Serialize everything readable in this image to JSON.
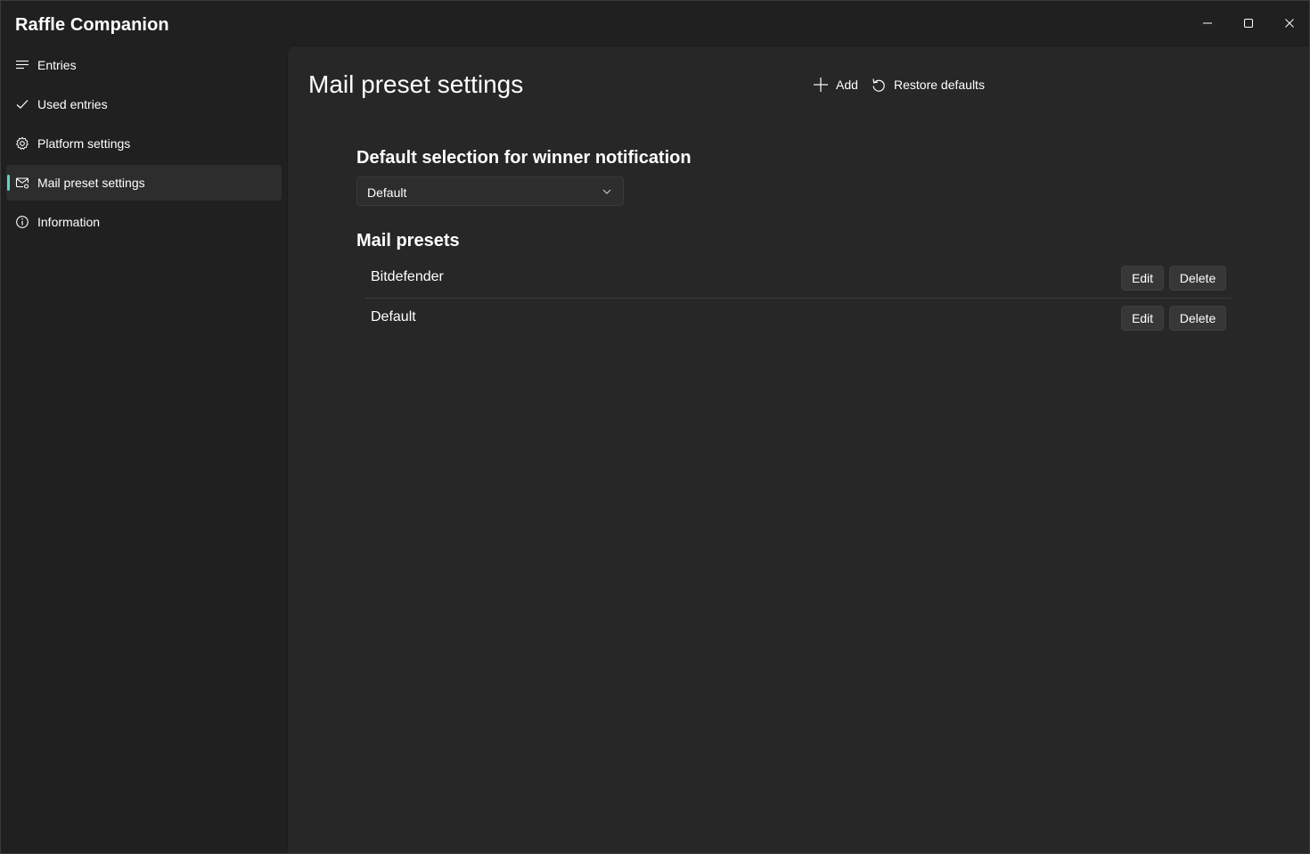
{
  "app": {
    "title": "Raffle Companion"
  },
  "window_controls": {
    "minimize_icon": "minimize-icon",
    "maximize_icon": "maximize-icon",
    "close_icon": "close-icon"
  },
  "sidebar": {
    "accent_color": "#5fd3c2",
    "items": [
      {
        "label": "Entries",
        "icon": "list-icon",
        "selected": false
      },
      {
        "label": "Used entries",
        "icon": "checkmark-icon",
        "selected": false
      },
      {
        "label": "Platform settings",
        "icon": "gear-icon",
        "selected": false
      },
      {
        "label": "Mail preset settings",
        "icon": "mail-settings-icon",
        "selected": true
      },
      {
        "label": "Information",
        "icon": "info-icon",
        "selected": false
      }
    ]
  },
  "main": {
    "title": "Mail preset settings",
    "commands": {
      "add_label": "Add",
      "restore_label": "Restore defaults"
    },
    "default_selection": {
      "heading": "Default selection for winner notification",
      "selected_value": "Default"
    },
    "presets": {
      "heading": "Mail presets",
      "items": [
        {
          "name": "Bitdefender",
          "edit_label": "Edit",
          "delete_label": "Delete"
        },
        {
          "name": "Default",
          "edit_label": "Edit",
          "delete_label": "Delete"
        }
      ]
    }
  }
}
